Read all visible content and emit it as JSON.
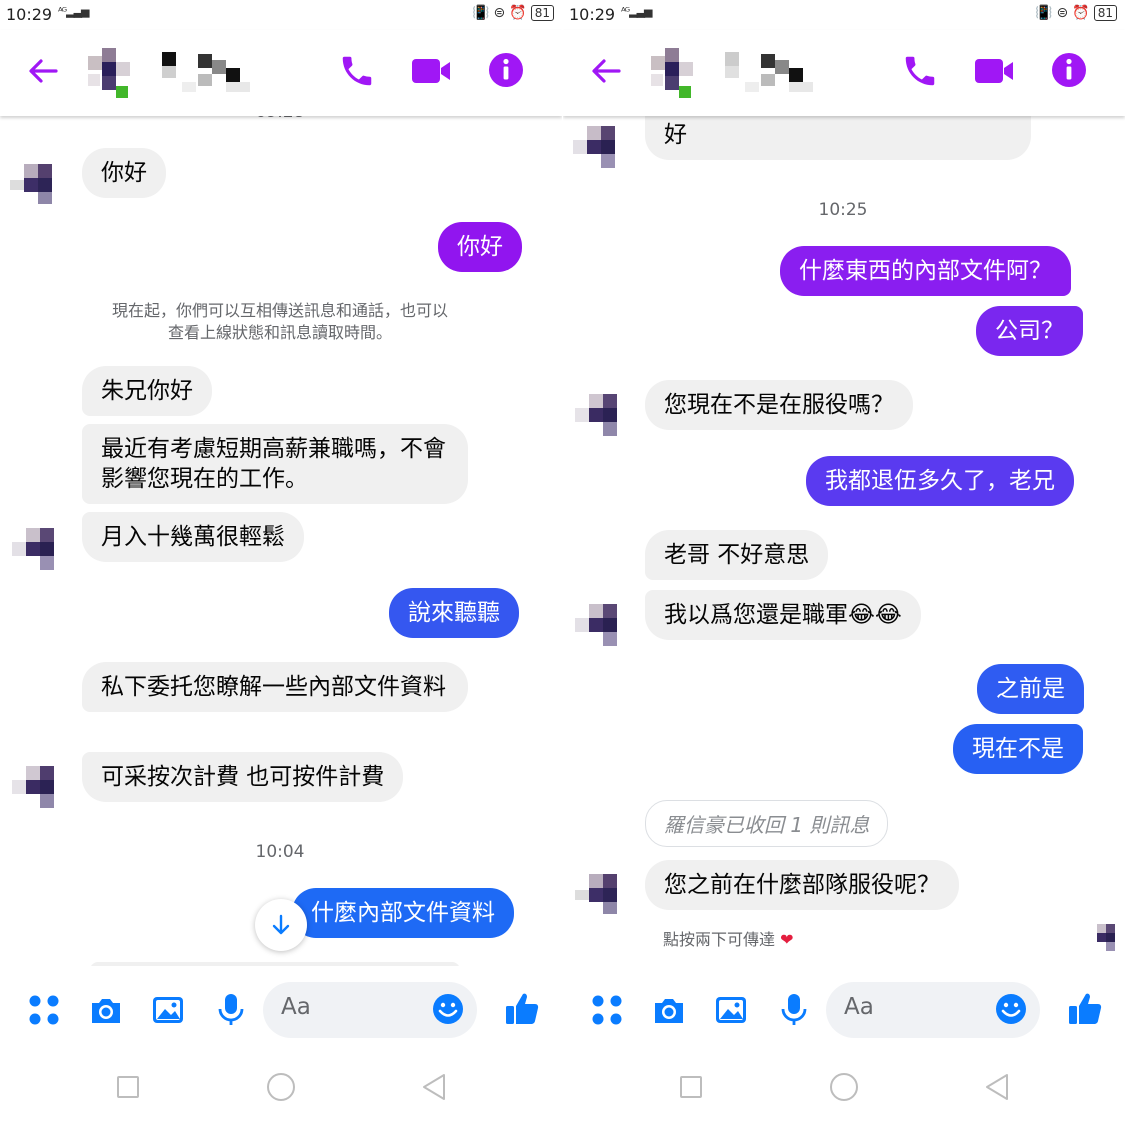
{
  "colors": {
    "accent": "#a017f5",
    "bubble_purple": "#8b1cf0",
    "bubble_violet": "#5e36f0",
    "bubble_blue": "#2563f5",
    "incoming_bg": "#f0f0f0",
    "messenger_blue": "#0a7cff"
  },
  "status": {
    "time": "10:29",
    "network": "4G",
    "battery": "81"
  },
  "icons": [
    "back-arrow-icon",
    "phone-icon",
    "video-camera-icon",
    "info-icon",
    "apps-icon",
    "camera-icon",
    "gallery-icon",
    "microphone-icon",
    "emoji-icon",
    "thumbs-up-icon",
    "scroll-down-icon"
  ],
  "left": {
    "messages": {
      "m1": "你好",
      "m2": "你好",
      "note_line1": "現在起，你們可以互相傳送訊息和通話，也可以",
      "note_line2": "查看上線狀態和訊息讀取時間。",
      "m3": "朱兄你好",
      "m4": "最近有考慮短期高薪兼職嗎，不會影響您現在的工作。",
      "m5": "月入十幾萬很輕鬆",
      "m6": "說來聽聽",
      "m7": "私下委托您瞭解一些內部文件資料",
      "m8": "可采按次計費 也可按件計費",
      "time1": "10:04",
      "m9": "什麼內部文件資料"
    },
    "composer_placeholder": "Aa"
  },
  "right": {
    "messages": {
      "m0": "好",
      "time1": "10:25",
      "m1": "什麼東西的內部文件阿？",
      "m2": "公司？",
      "m3": "您現在不是在服役嗎？",
      "m4": "我都退伍多久了，老兄",
      "m5": "老哥  不好意思",
      "m6": "我以爲您還是職軍",
      "m6_emoji": "😂😂",
      "m7": "之前是",
      "m8": "現在不是",
      "recalled": "羅信豪已收回 1 則訊息",
      "m9": "您之前在什麼部隊服役呢？",
      "hint": "點按兩下可傳達"
    },
    "composer_placeholder": "Aa"
  }
}
